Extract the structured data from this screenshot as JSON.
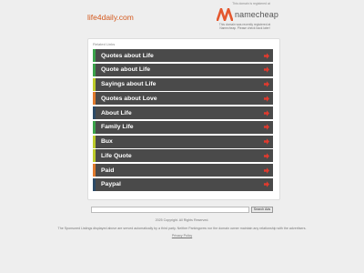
{
  "header": {
    "site_name": "life4daily.com",
    "registrar_note": "This domain is registered at",
    "registrar_name": "namecheap",
    "domain_note": "This domain was recently registered at Namecheap. Please check back later!"
  },
  "links": {
    "heading": "Related Links",
    "items": [
      {
        "label": "Quotes about Life",
        "accent": "#3aa24a"
      },
      {
        "label": "Quote about Life",
        "accent": "#3aa24a"
      },
      {
        "label": "Sayings about Life",
        "accent": "#bccb2a"
      },
      {
        "label": "Quotes about Love",
        "accent": "#e07a2e"
      },
      {
        "label": "About Life",
        "accent": "#2c4a66"
      },
      {
        "label": "Family Life",
        "accent": "#3aa24a"
      },
      {
        "label": "Bux",
        "accent": "#bccb2a"
      },
      {
        "label": "Life Quote",
        "accent": "#bccb2a"
      },
      {
        "label": "Paid",
        "accent": "#e07a2e"
      },
      {
        "label": "Paypal",
        "accent": "#2c4a66"
      }
    ],
    "arrow_color": "#e03a2e"
  },
  "search": {
    "value": "",
    "button_label": "Search Ads"
  },
  "footer": {
    "copyright": "2025 Copyright. All Rights Reserved.",
    "disclaimer": "The Sponsored Listings displayed above are served automatically by a third party. Neither Parkingcrew nor the domain owner maintain any relationship with the advertisers.",
    "privacy_link": "Privacy Policy"
  }
}
